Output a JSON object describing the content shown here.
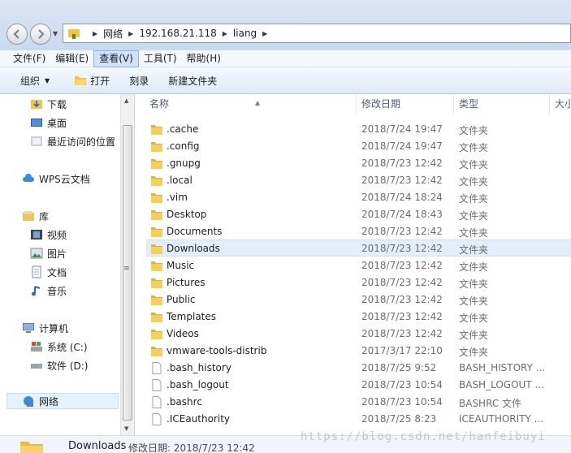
{
  "address": {
    "crumbs": [
      "网络",
      "192.168.21.118",
      "liang"
    ]
  },
  "menu": [
    "文件(F)",
    "编辑(E)",
    "查看(V)",
    "工具(T)",
    "帮助(H)"
  ],
  "toolbar": {
    "organize": "组织",
    "open": "打开",
    "burn": "刻录",
    "new_folder": "新建文件夹"
  },
  "nav": {
    "favorites": [
      "下载",
      "桌面",
      "最近访问的位置"
    ],
    "wps": "WPS云文档",
    "library": "库",
    "library_items": [
      "视频",
      "图片",
      "文档",
      "音乐"
    ],
    "computer": "计算机",
    "drives": [
      "系统 (C:)",
      "软件 (D:)"
    ],
    "network": "网络"
  },
  "columns": {
    "name": "名称",
    "date": "修改日期",
    "type": "类型",
    "size": "大小"
  },
  "files": [
    {
      "name": ".cache",
      "date": "2018/7/24 19:47",
      "type": "文件夹",
      "kind": "folder"
    },
    {
      "name": ".config",
      "date": "2018/7/24 19:47",
      "type": "文件夹",
      "kind": "folder"
    },
    {
      "name": ".gnupg",
      "date": "2018/7/23 12:42",
      "type": "文件夹",
      "kind": "folder"
    },
    {
      "name": ".local",
      "date": "2018/7/23 12:42",
      "type": "文件夹",
      "kind": "folder"
    },
    {
      "name": ".vim",
      "date": "2018/7/24 18:24",
      "type": "文件夹",
      "kind": "folder"
    },
    {
      "name": "Desktop",
      "date": "2018/7/24 18:43",
      "type": "文件夹",
      "kind": "folder"
    },
    {
      "name": "Documents",
      "date": "2018/7/23 12:42",
      "type": "文件夹",
      "kind": "folder"
    },
    {
      "name": "Downloads",
      "date": "2018/7/23 12:42",
      "type": "文件夹",
      "kind": "folder",
      "selected": true
    },
    {
      "name": "Music",
      "date": "2018/7/23 12:42",
      "type": "文件夹",
      "kind": "folder"
    },
    {
      "name": "Pictures",
      "date": "2018/7/23 12:42",
      "type": "文件夹",
      "kind": "folder"
    },
    {
      "name": "Public",
      "date": "2018/7/23 12:42",
      "type": "文件夹",
      "kind": "folder"
    },
    {
      "name": "Templates",
      "date": "2018/7/23 12:42",
      "type": "文件夹",
      "kind": "folder"
    },
    {
      "name": "Videos",
      "date": "2018/7/23 12:42",
      "type": "文件夹",
      "kind": "folder"
    },
    {
      "name": "vmware-tools-distrib",
      "date": "2017/3/17 22:10",
      "type": "文件夹",
      "kind": "folder"
    },
    {
      "name": ".bash_history",
      "date": "2018/7/25 9:52",
      "type": "BASH_HISTORY ...",
      "kind": "file"
    },
    {
      "name": ".bash_logout",
      "date": "2018/7/23 10:54",
      "type": "BASH_LOGOUT ...",
      "kind": "file"
    },
    {
      "name": ".bashrc",
      "date": "2018/7/23 10:54",
      "type": "BASHRC 文件",
      "kind": "file"
    },
    {
      "name": ".ICEauthority",
      "date": "2018/7/25 8:23",
      "type": "ICEAUTHORITY ...",
      "kind": "file"
    }
  ],
  "status": {
    "name": "Downloads",
    "label": "修改日期: 2018/7/23 12:42"
  },
  "watermark": "https://blog.csdn.net/hanfeibuyi",
  "colors": {
    "folder": "#f2c544",
    "selection": "#e3eefa",
    "menu_active": "#cfe2fa"
  }
}
